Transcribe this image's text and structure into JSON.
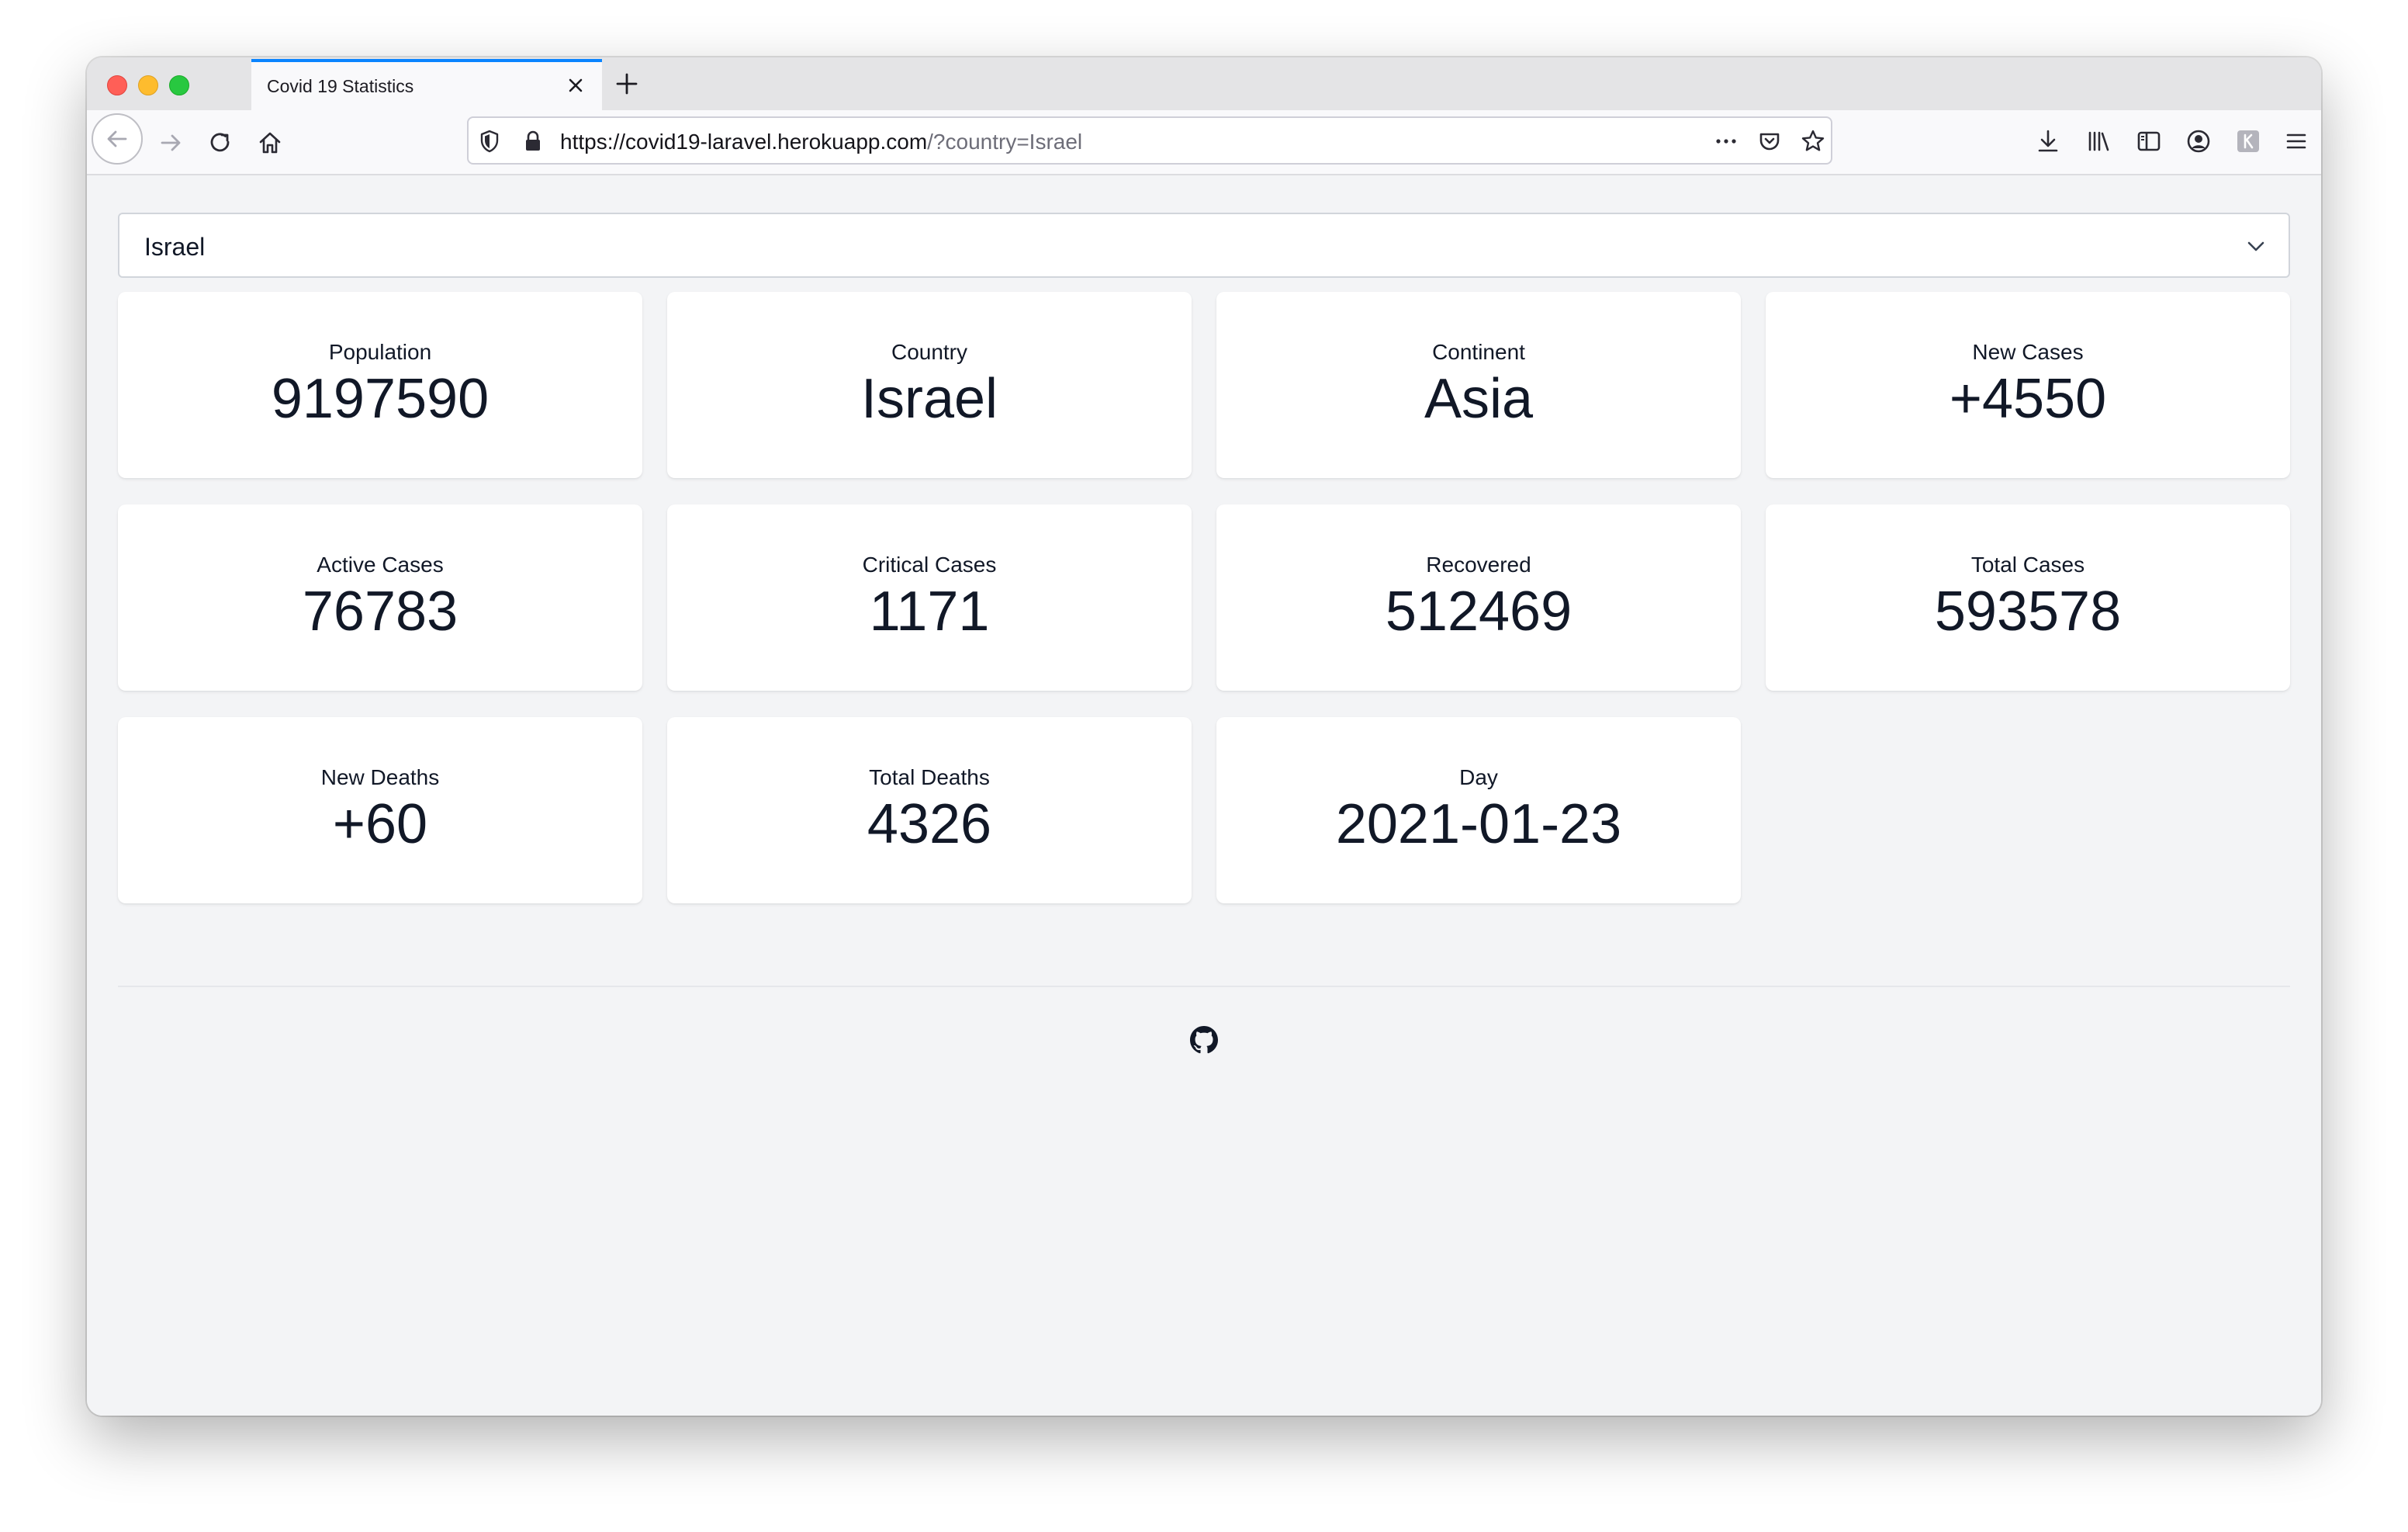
{
  "browser": {
    "tab_title": "Covid 19 Statistics",
    "url_host": "https://covid19-laravel.herokuapp.com",
    "url_path": "/?country=Israel"
  },
  "country_select": {
    "selected": "Israel"
  },
  "stats": [
    {
      "label": "Population",
      "value": "9197590"
    },
    {
      "label": "Country",
      "value": "Israel"
    },
    {
      "label": "Continent",
      "value": "Asia"
    },
    {
      "label": "New Cases",
      "value": "+4550"
    },
    {
      "label": "Active Cases",
      "value": "76783"
    },
    {
      "label": "Critical Cases",
      "value": "1171"
    },
    {
      "label": "Recovered",
      "value": "512469"
    },
    {
      "label": "Total Cases",
      "value": "593578"
    },
    {
      "label": "New Deaths",
      "value": "+60"
    },
    {
      "label": "Total Deaths",
      "value": "4326"
    },
    {
      "label": "Day",
      "value": "2021-01-23"
    }
  ],
  "icons": {
    "footer": "github-icon"
  },
  "colors": {
    "tab_accent": "#0a84ff",
    "page_background": "#f3f4f6",
    "card_background": "#ffffff",
    "text": "#111827"
  }
}
